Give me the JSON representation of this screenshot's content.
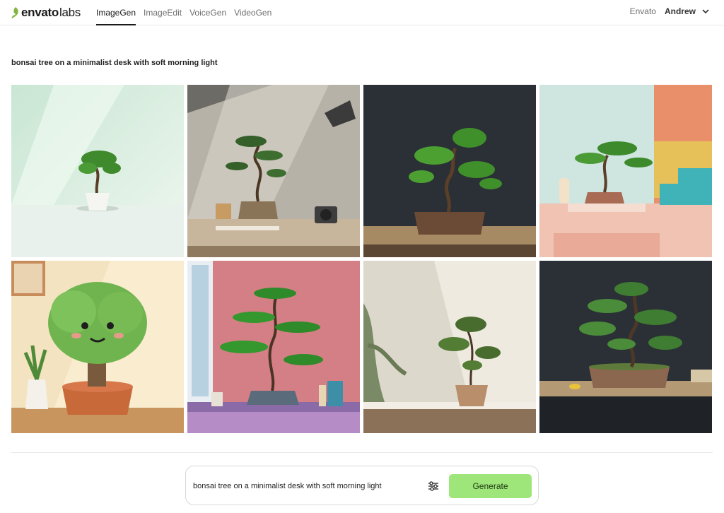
{
  "nav": {
    "logo_brand": "envato",
    "logo_labs": "labs",
    "logo_icon": "leaf-icon",
    "tabs": [
      {
        "label": "ImageGen",
        "active": true
      },
      {
        "label": "ImageEdit",
        "active": false
      },
      {
        "label": "VoiceGen",
        "active": false
      },
      {
        "label": "VideoGen",
        "active": false
      }
    ],
    "envato_link": "Envato",
    "user_name": "Andrew",
    "user_menu_icon": "chevron-down-icon"
  },
  "prompt": {
    "title": "bonsai tree on a minimalist desk with soft morning light"
  },
  "gallery": {
    "images": [
      {
        "subject": "bonsai in white pot on white desk, mint wall"
      },
      {
        "subject": "bonsai on desk with camera and lamp"
      },
      {
        "subject": "bonsai in rectangular pot, dark background"
      },
      {
        "subject": "bonsai on pink and teal geometric steps"
      },
      {
        "subject": "cartoon smiling bonsai in orange pot"
      },
      {
        "subject": "bonsai in pink room by window"
      },
      {
        "subject": "bonsai in clay pot with window shadows"
      },
      {
        "subject": "bonsai in rectangular pot on dark shelf"
      }
    ]
  },
  "composer": {
    "input_value": "bonsai tree on a minimalist desk with soft morning light",
    "settings_icon": "sliders-icon",
    "generate_label": "Generate"
  },
  "colors": {
    "accent": "#9ee57a",
    "logo_green": "#82b540",
    "text": "#1c1c1c"
  }
}
